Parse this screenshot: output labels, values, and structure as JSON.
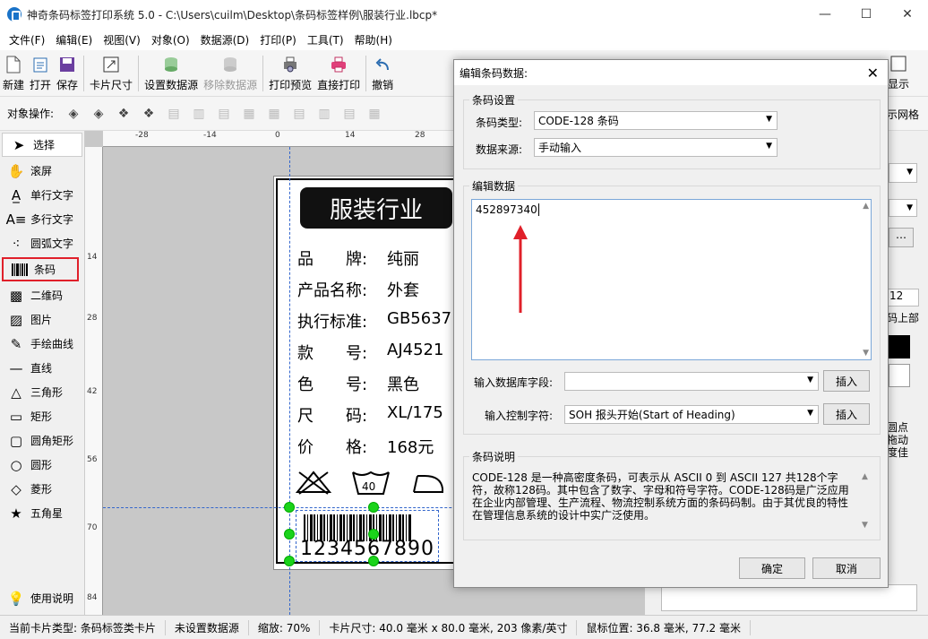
{
  "window": {
    "title": "神奇条码标签打印系统 5.0 - C:\\Users\\cuilm\\Desktop\\条码标签样例\\服装行业.lbcp*"
  },
  "menu": [
    "文件(F)",
    "编辑(E)",
    "视图(V)",
    "对象(O)",
    "数据源(D)",
    "打印(P)",
    "工具(T)",
    "帮助(H)"
  ],
  "toolbar": {
    "new": "新建",
    "open": "打开",
    "save": "保存",
    "card_size": "卡片尺寸",
    "set_datasource": "设置数据源",
    "remove_datasource": "移除数据源",
    "print_preview": "打印预览",
    "direct_print": "直接打印",
    "undo": "撤销",
    "show": "显示"
  },
  "objbar": {
    "label": "对象操作:",
    "right_text": "示网格"
  },
  "tools": [
    "选择",
    "滚屏",
    "单行文字",
    "多行文字",
    "圆弧文字",
    "条码",
    "二维码",
    "图片",
    "手绘曲线",
    "直线",
    "三角形",
    "矩形",
    "圆角矩形",
    "圆形",
    "菱形",
    "五角星"
  ],
  "help": "使用说明",
  "ruler": {
    "top": [
      "-28",
      "-14",
      "0",
      "14",
      "28"
    ],
    "left": [
      "14",
      "28",
      "42",
      "56",
      "70",
      "84"
    ]
  },
  "card": {
    "header": "服装行业",
    "rows": [
      {
        "k": "品　　牌:",
        "v": "纯丽"
      },
      {
        "k": "产品名称:",
        "v": "外套"
      },
      {
        "k": "执行标准:",
        "v": "GB5637"
      },
      {
        "k": "款　　号:",
        "v": "AJ4521"
      },
      {
        "k": "色　　号:",
        "v": "黑色"
      },
      {
        "k": "尺　　码:",
        "v": "XL/175"
      },
      {
        "k": "价　　格:",
        "v": "168元"
      }
    ],
    "wash_temp": "40",
    "barcode_text": "1234567890"
  },
  "rightpanel": {
    "t1": "12",
    "t2": "码上部",
    "t3": "圆点",
    "t4": "拖动",
    "t5": "度佳"
  },
  "status": {
    "card_type": "当前卡片类型: 条码标签类卡片",
    "datasource": "未设置数据源",
    "zoom": "缩放: 70%",
    "card_size": "卡片尺寸: 40.0 毫米 x 80.0 毫米, 203 像素/英寸",
    "mouse": "鼠标位置: 36.8 毫米, 77.2 毫米"
  },
  "dialog": {
    "title": "编辑条码数据:",
    "settings_group": "条码设置",
    "type_label": "条码类型:",
    "type_value": "CODE-128 条码",
    "source_label": "数据来源:",
    "source_value": "手动输入",
    "edit_group": "编辑数据",
    "data_value": "452897340",
    "db_field_label": "输入数据库字段:",
    "db_field_value": "",
    "insert1": "插入",
    "ctrl_label": "输入控制字符:",
    "ctrl_value": "SOH  报头开始(Start of Heading)",
    "insert2": "插入",
    "desc_group": "条码说明",
    "desc_text": "CODE-128 是一种高密度条码，可表示从 ASCII 0 到 ASCII 127 共128个字符，故称128码。其中包含了数字、字母和符号字符。CODE-128码是广泛应用在企业内部管理、生产流程、物流控制系统方面的条码码制。由于其优良的特性在管理信息系统的设计中实广泛使用。",
    "ok": "确定",
    "cancel": "取消"
  },
  "colors": {
    "highlight": "#e0202a",
    "handle": "#1ad31a",
    "arrow": "#e0202a"
  }
}
